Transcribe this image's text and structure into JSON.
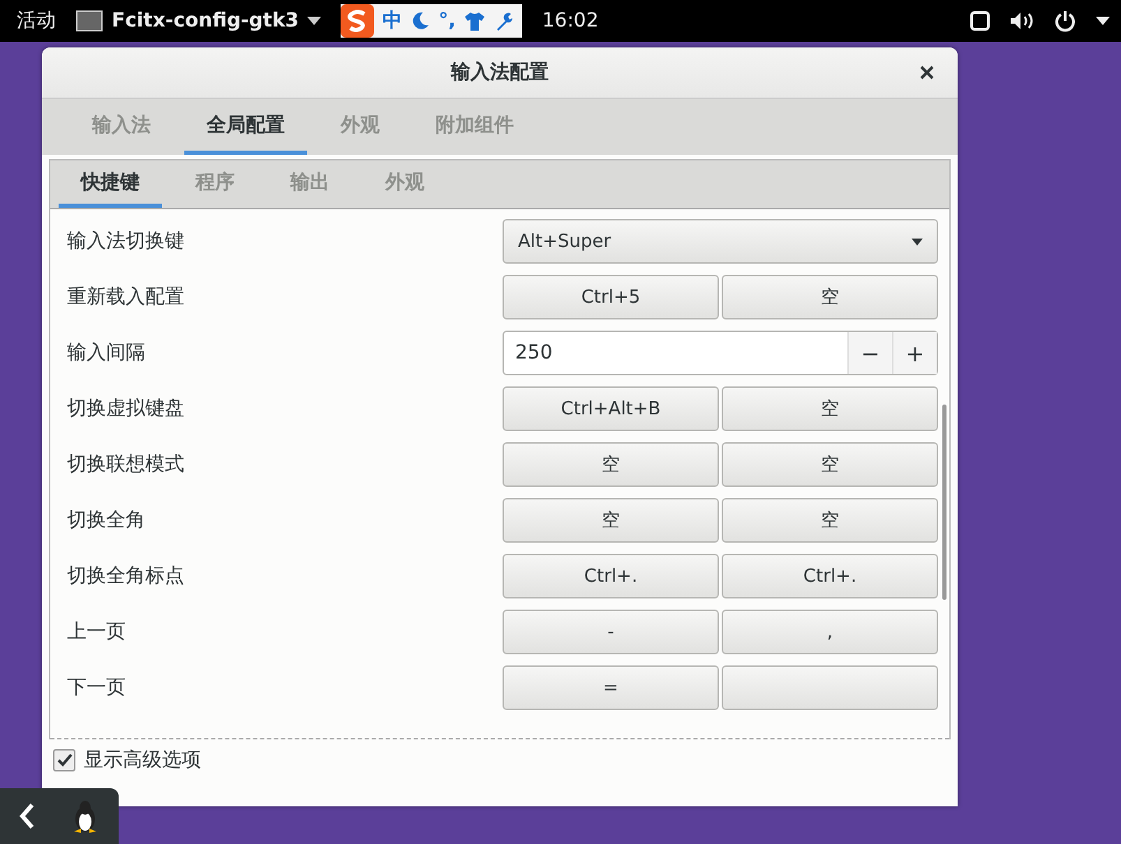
{
  "top_bar": {
    "activities": "活动",
    "app_name": "Fcitx-config-gtk3",
    "ime_tray": [
      "中",
      "°,"
    ],
    "clock": "16:02"
  },
  "window": {
    "title": "输入法配置"
  },
  "tabs": [
    {
      "label": "输入法",
      "selected": false
    },
    {
      "label": "全局配置",
      "selected": true
    },
    {
      "label": "外观",
      "selected": false
    },
    {
      "label": "附加组件",
      "selected": false
    }
  ],
  "subtabs": [
    {
      "label": "快捷键",
      "selected": true
    },
    {
      "label": "程序",
      "selected": false
    },
    {
      "label": "输出",
      "selected": false
    },
    {
      "label": "外观",
      "selected": false
    }
  ],
  "rows": [
    {
      "label": "输入法切换键",
      "kind": "dropdown",
      "value": "Alt+Super"
    },
    {
      "label": "重新载入配置",
      "kind": "keys",
      "keys": [
        "Ctrl+5",
        "空"
      ]
    },
    {
      "label": "输入间隔",
      "kind": "spin",
      "value": "250",
      "minus": "−",
      "plus": "+"
    },
    {
      "label": "切换虚拟键盘",
      "kind": "keys",
      "keys": [
        "Ctrl+Alt+B",
        "空"
      ]
    },
    {
      "label": "切换联想模式",
      "kind": "keys",
      "keys": [
        "空",
        "空"
      ]
    },
    {
      "label": "切换全角",
      "kind": "keys",
      "keys": [
        "空",
        "空"
      ]
    },
    {
      "label": "切换全角标点",
      "kind": "keys",
      "keys": [
        "Ctrl+.",
        "Ctrl+."
      ]
    },
    {
      "label": "上一页",
      "kind": "keys",
      "keys": [
        "-",
        ","
      ]
    },
    {
      "label": "下一页",
      "kind": "keys",
      "keys": [
        "="
      ]
    }
  ],
  "advanced": {
    "label": "显示高级选项",
    "checked": true
  }
}
